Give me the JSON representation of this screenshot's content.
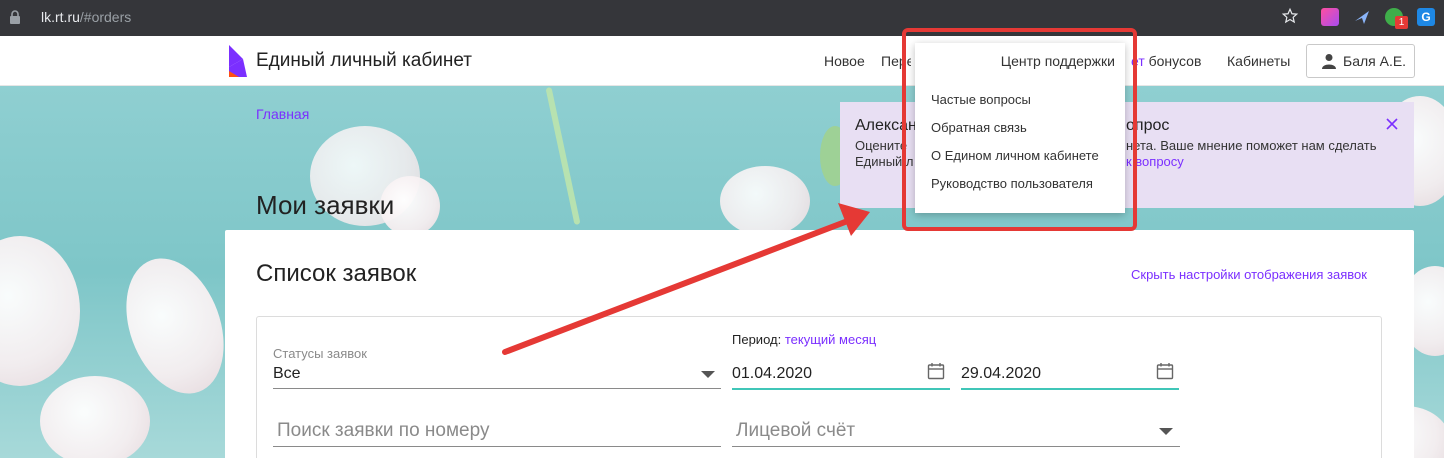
{
  "browser": {
    "url_host": "lk.rt.ru",
    "url_path": "/#orders",
    "badge_count": "1",
    "ext4_letter": "G"
  },
  "header": {
    "site_title": "Единый личный кабинет",
    "nav": {
      "novoe": "Новое",
      "per": "Пере",
      "bonus_hl": "ет",
      "bonus_rest": " бонусов",
      "cabinets": "Кабинеты"
    },
    "user_name": "Баля А.Е."
  },
  "breadcrumb": "Главная",
  "page_title": "Мои заявки",
  "notice": {
    "title_a": "Алексан",
    "title_b": "опрос",
    "line1_a": "Оцените",
    "line1_b": "нета. Ваше мнение поможет нам сделать",
    "line2_a": "Единый л",
    "line2_b": "к вопросу"
  },
  "support_menu": {
    "title": "Центр поддержки",
    "items": [
      "Частые вопросы",
      "Обратная связь",
      "О Едином личном кабинете",
      "Руководство пользователя"
    ]
  },
  "card": {
    "title": "Список заявок",
    "hide_link": "Скрыть настройки отображения заявок",
    "status_label": "Статусы заявок",
    "status_value": "Все",
    "period_label": "Период:",
    "period_value": "текущий месяц",
    "date_from": "01.04.2020",
    "date_to": "29.04.2020",
    "search_placeholder": "Поиск заявки по номеру",
    "account_placeholder": "Лицевой счёт"
  },
  "colors": {
    "accent": "#7b2fff",
    "date_underline": "#40c6b8",
    "annotation": "#e53935"
  }
}
